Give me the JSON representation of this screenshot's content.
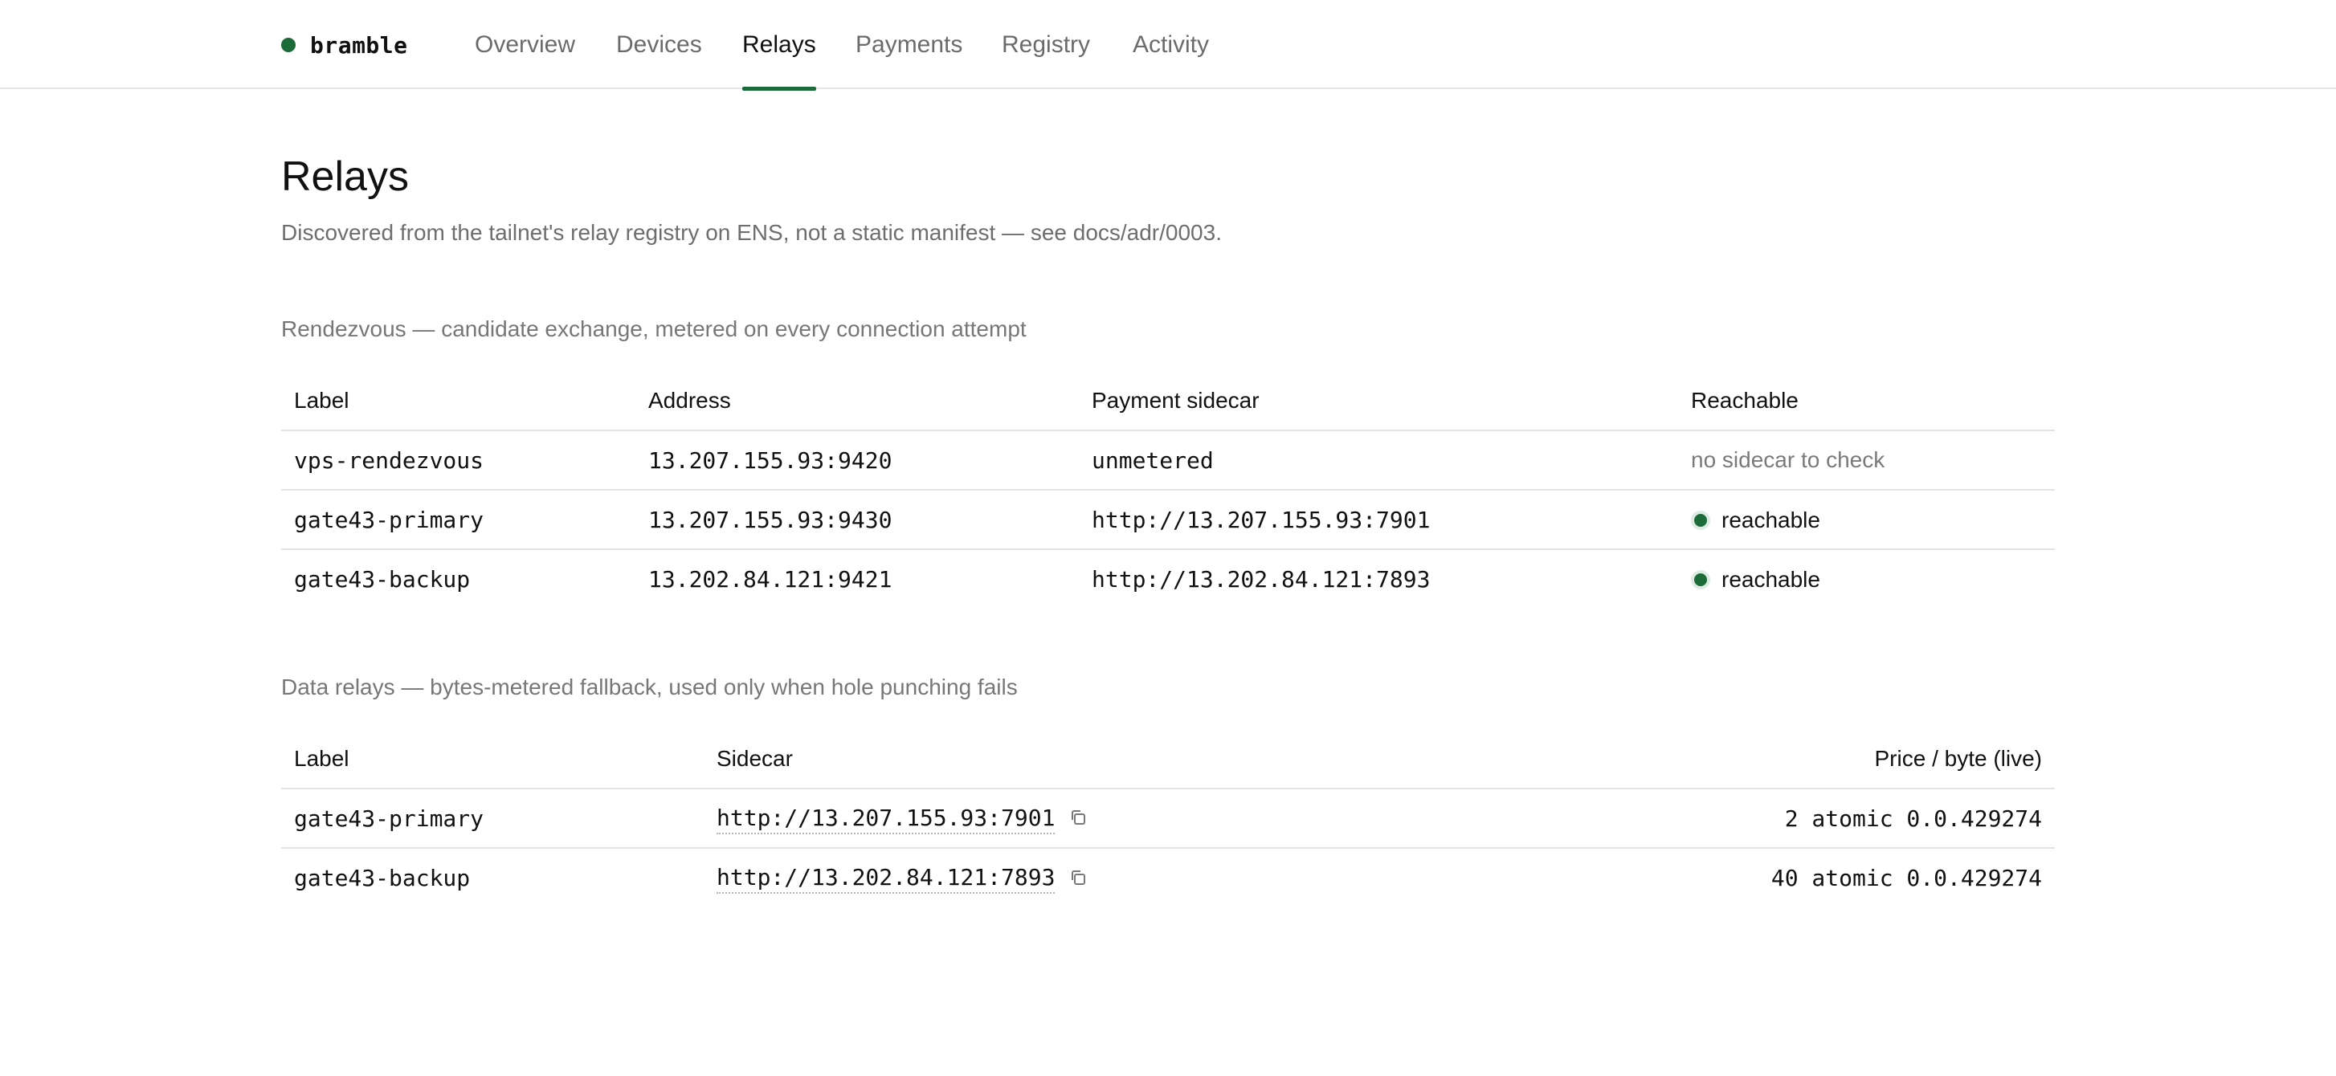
{
  "brand": {
    "name": "bramble",
    "status_color": "#1e6b3a"
  },
  "nav": {
    "tabs": [
      {
        "label": "Overview"
      },
      {
        "label": "Devices"
      },
      {
        "label": "Relays",
        "active": true
      },
      {
        "label": "Payments"
      },
      {
        "label": "Registry"
      },
      {
        "label": "Activity"
      }
    ]
  },
  "page": {
    "title": "Relays",
    "subtitle": "Discovered from the tailnet's relay registry on ENS, not a static manifest — see docs/adr/0003."
  },
  "rendezvous": {
    "caption": "Rendezvous — candidate exchange, metered on every connection attempt",
    "headers": {
      "label": "Label",
      "address": "Address",
      "sidecar": "Payment sidecar",
      "reachable": "Reachable"
    },
    "rows": [
      {
        "label": "vps-rendezvous",
        "address": "13.207.155.93:9420",
        "sidecar": "unmetered",
        "reachable": "no sidecar to check"
      },
      {
        "label": "gate43-primary",
        "address": "13.207.155.93:9430",
        "sidecar": "http://13.207.155.93:7901",
        "reachable": "reachable"
      },
      {
        "label": "gate43-backup",
        "address": "13.202.84.121:9421",
        "sidecar": "http://13.202.84.121:7893",
        "reachable": "reachable"
      }
    ]
  },
  "data_relays": {
    "caption": "Data relays — bytes-metered fallback, used only when hole punching fails",
    "headers": {
      "label": "Label",
      "sidecar": "Sidecar",
      "price": "Price / byte (live)"
    },
    "rows": [
      {
        "label": "gate43-primary",
        "sidecar": "http://13.207.155.93:7901",
        "price": "2 atomic 0.0.429274"
      },
      {
        "label": "gate43-backup",
        "sidecar": "http://13.202.84.121:7893",
        "price": "40 atomic 0.0.429274"
      }
    ]
  },
  "colors": {
    "accent": "#1e6b3a",
    "muted_text": "#6e6e6e",
    "divider": "#e3e3e3"
  }
}
